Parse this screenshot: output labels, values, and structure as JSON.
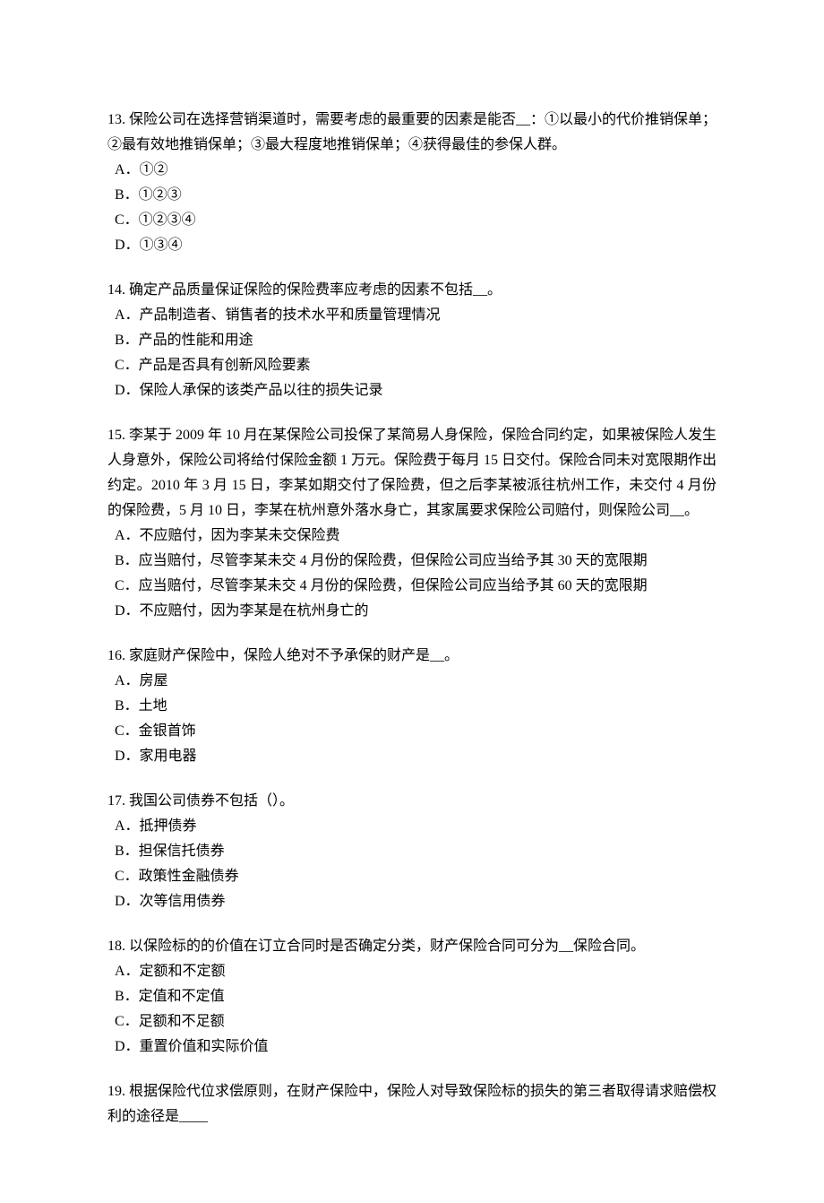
{
  "questions": [
    {
      "num": "13.",
      "text": "保险公司在选择营销渠道时，需要考虑的最重要的因素是能否__：①以最小的代价推销保单；②最有效地推销保单；③最大程度地推销保单；④获得最佳的参保人群。",
      "options": [
        "A．①②",
        "B．①②③",
        "C．①②③④",
        "D．①③④"
      ]
    },
    {
      "num": "14.",
      "text": "确定产品质量保证保险的保险费率应考虑的因素不包括__。",
      "options": [
        "A．产品制造者、销售者的技术水平和质量管理情况",
        "B．产品的性能和用途",
        "C．产品是否具有创新风险要素",
        "D．保险人承保的该类产品以往的损失记录"
      ]
    },
    {
      "num": "15.",
      "text": "李某于 2009 年 10 月在某保险公司投保了某简易人身保险，保险合同约定，如果被保险人发生人身意外，保险公司将给付保险金额 1 万元。保险费于每月 15 日交付。保险合同未对宽限期作出约定。2010 年 3 月 15 日，李某如期交付了保险费，但之后李某被派往杭州工作，未交付 4 月份的保险费，5 月 10 日，李某在杭州意外落水身亡，其家属要求保险公司赔付，则保险公司__。",
      "options": [
        "A．不应赔付，因为李某未交保险费",
        "B．应当赔付，尽管李某未交 4 月份的保险费，但保险公司应当给予其 30 天的宽限期",
        "C．应当赔付，尽管李某未交 4 月份的保险费，但保险公司应当给予其 60 天的宽限期",
        "D．不应赔付，因为李某是在杭州身亡的"
      ]
    },
    {
      "num": "16.",
      "text": "家庭财产保险中，保险人绝对不予承保的财产是__。",
      "options": [
        "A．房屋",
        "B．土地",
        "C．金银首饰",
        "D．家用电器"
      ]
    },
    {
      "num": "17.",
      "text": "我国公司债券不包括（）。",
      "options": [
        "A．抵押债券",
        "B．担保信托债券",
        "C．政策性金融债券",
        "D．次等信用债券"
      ]
    },
    {
      "num": "18.",
      "text": "以保险标的的价值在订立合同时是否确定分类，财产保险合同可分为__保险合同。",
      "options": [
        "A．定额和不定额",
        "B．定值和不定值",
        "C．足额和不足额",
        "D．重置价值和实际价值"
      ]
    },
    {
      "num": "19.",
      "text": "根据保险代位求偿原则，在财产保险中，保险人对导致保险标的损失的第三者取得请求赔偿权利的途径是____",
      "options": []
    }
  ]
}
